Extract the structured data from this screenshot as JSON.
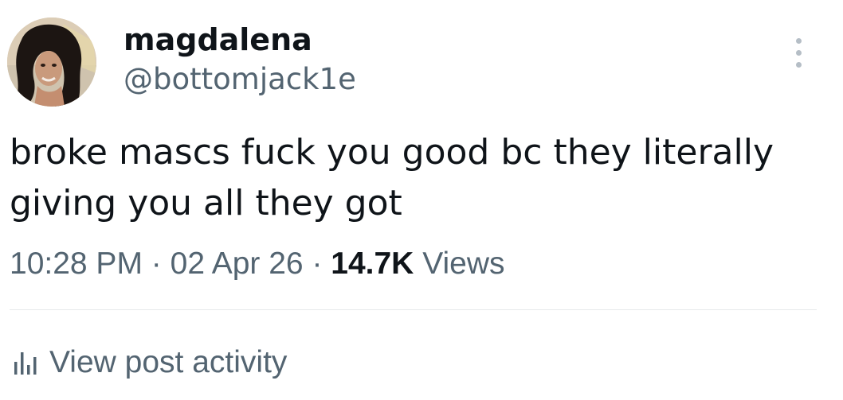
{
  "author": {
    "display_name": "magdalena",
    "handle": "@bottomjack1e"
  },
  "tweet": {
    "text": "broke mascs fuck you good bc they literally giving you all they got"
  },
  "meta": {
    "time": "10:28 PM",
    "separator": "·",
    "date": "02 Apr 26",
    "views_count": "14.7K",
    "views_label": "Views"
  },
  "activity": {
    "label": "View post activity",
    "icon": "bar-chart-icon"
  },
  "more": {
    "icon": "more-vertical-icon"
  },
  "colors": {
    "primary_text": "#0f1419",
    "secondary_text": "#536471",
    "divider": "#e7e9eb",
    "more_dots": "#b5bec6"
  }
}
